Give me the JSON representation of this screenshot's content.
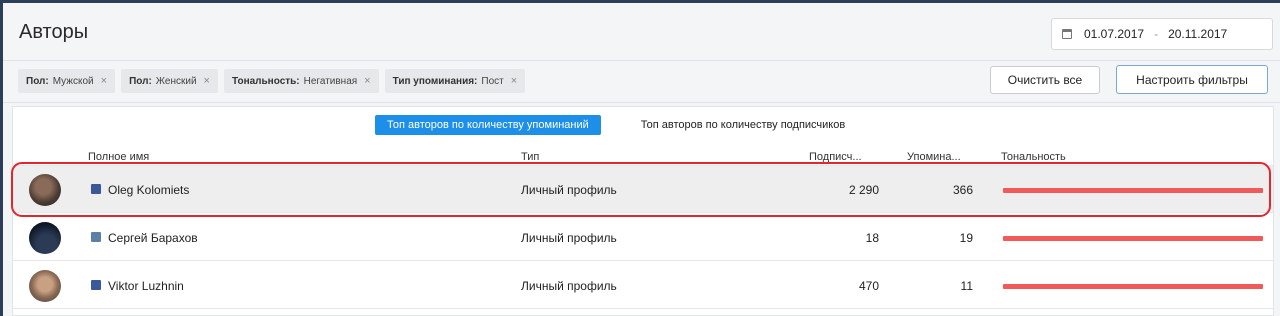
{
  "header": {
    "title": "Авторы",
    "date_from": "01.07.2017",
    "date_to": "20.11.2017",
    "date_separator": "-"
  },
  "filters": [
    {
      "key": "Пол:",
      "value": "Мужской"
    },
    {
      "key": "Пол:",
      "value": "Женский"
    },
    {
      "key": "Тональность:",
      "value": "Негативная"
    },
    {
      "key": "Тип упоминания:",
      "value": "Пост"
    }
  ],
  "filter_remove_glyph": "×",
  "toolbar": {
    "clear_label": "Очистить все",
    "configure_label": "Настроить фильтры"
  },
  "tabs": [
    {
      "label": "Топ авторов по количеству упоминаний",
      "active": true
    },
    {
      "label": "Топ авторов по количеству подписчиков",
      "active": false
    }
  ],
  "columns": {
    "name": "Полное имя",
    "type": "Тип",
    "subscribers": "Подписч...",
    "mentions": "Упомина...",
    "sentiment": "Тональность"
  },
  "rows": [
    {
      "name": "Oleg Kolomiets",
      "network": "facebook-icon",
      "type": "Личный профиль",
      "subscribers": "2 290",
      "mentions": "366",
      "sentiment_negative": 1.0
    },
    {
      "name": "Сергей Барахов",
      "network": "vk-icon",
      "type": "Личный профиль",
      "subscribers": "18",
      "mentions": "19",
      "sentiment_negative": 1.0
    },
    {
      "name": "Viktor Luzhnin",
      "network": "facebook-icon",
      "type": "Личный профиль",
      "subscribers": "470",
      "mentions": "11",
      "sentiment_negative": 1.0
    }
  ],
  "colors": {
    "accent": "#1e8fe8",
    "negative": "#f05a5a",
    "highlight": "#e3262e"
  }
}
